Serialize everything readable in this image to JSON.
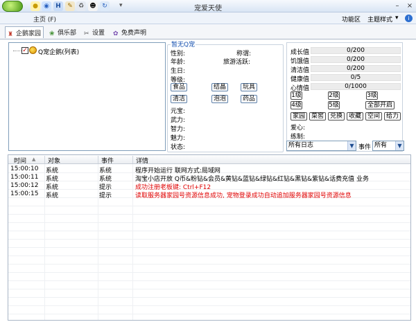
{
  "window": {
    "title": "宠爱天使",
    "toolbar_icons": [
      "bulb-icon",
      "globe-icon",
      "bookmark-icon",
      "tools-icon",
      "recycle-icon",
      "penguin-icon",
      "refresh-icon"
    ],
    "overflow": "▾",
    "min": "–",
    "close": "×"
  },
  "menu": {
    "home": "主页 (F)",
    "function_area": "功能区",
    "theme": "主题样式",
    "theme_arrow": "▾",
    "help": "i"
  },
  "tabs": [
    {
      "label": "企鹅家园",
      "icon": "penguin-icon"
    },
    {
      "label": "俱乐部",
      "icon": "club-icon"
    },
    {
      "label": "设置",
      "icon": "wrench-icon"
    },
    {
      "label": "免费声明",
      "icon": "disclaimer-icon"
    }
  ],
  "tree": {
    "item": "Q宠企鹅(列表)"
  },
  "info": {
    "title": "暂无Q宠",
    "gender": "性别:",
    "nickname": "称谓:",
    "age": "年龄:",
    "travel": "旅游活跃:",
    "birthday": "生日:",
    "level": "等级:",
    "buttons_row1": [
      "食品",
      "结晶",
      "玩具"
    ],
    "buttons_row2": [
      "清洁",
      "泡泡",
      "药品"
    ],
    "yuanbao": "元宝:",
    "force": "武力:",
    "intellect": "智力:",
    "charm": "魅力:",
    "status": "状态:"
  },
  "stats": {
    "rows": [
      {
        "label": "成长值",
        "value": "0/200"
      },
      {
        "label": "饥饿值",
        "value": "0/200"
      },
      {
        "label": "清洁值",
        "value": "0/200"
      },
      {
        "label": "健康值",
        "value": "0/5"
      },
      {
        "label": "心情值",
        "value": "0/1000"
      }
    ],
    "level_buttons": [
      "1级",
      "2级",
      "3级",
      "4级",
      "5级",
      "全部开启"
    ],
    "action_buttons": [
      "家园",
      "菜窖",
      "兑换",
      "收藏",
      "空间",
      "给力"
    ],
    "love": "爱心:",
    "train": "练制:",
    "log_filter": "所有日志",
    "event_label": "事件",
    "event_filter": "所有"
  },
  "log": {
    "headers": {
      "time": "时间",
      "sort": "▲",
      "object": "对象",
      "event": "事件",
      "detail": "详情"
    },
    "rows": [
      {
        "time": "15:00:10",
        "object": "系统",
        "event": "系统",
        "detail": "程序开始运行 联网方式:局域网",
        "color": "#000000"
      },
      {
        "time": "15:00:11",
        "object": "系统",
        "event": "系统",
        "detail": "淘宝小店开放 Q币&粉钻&会员&黄钻&蓝钻&绿钻&红钻&黑钻&紫钻&话费充值 业务",
        "color": "#000000"
      },
      {
        "time": "15:00:12",
        "object": "系统",
        "event": "提示",
        "detail": "成功注册老板键: Ctrl+F12",
        "color": "#e00000"
      },
      {
        "time": "15:00:15",
        "object": "系统",
        "event": "提示",
        "detail": "读取服务器家园号资源信息成功, 宠物登录成功自动追加服务器家园号资源信息",
        "color": "#e00000"
      }
    ]
  }
}
